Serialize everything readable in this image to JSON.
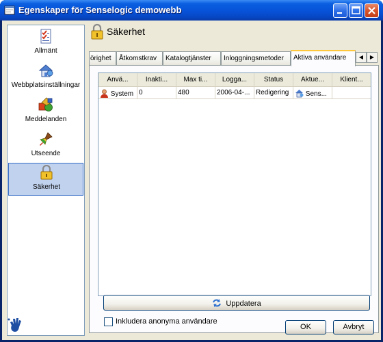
{
  "window": {
    "title": "Egenskaper för Senselogic demowebb"
  },
  "sidebar": {
    "items": [
      {
        "label": "Allmänt",
        "icon": "checklist-icon"
      },
      {
        "label": "Webbplatsinställningar",
        "icon": "house-icon"
      },
      {
        "label": "Meddelanden",
        "icon": "shapes-icon"
      },
      {
        "label": "Utseende",
        "icon": "paintbrush-icon"
      },
      {
        "label": "Säkerhet",
        "icon": "padlock-icon",
        "selected": true
      }
    ]
  },
  "page": {
    "title": "Säkerhet"
  },
  "tabs": [
    {
      "label": "Behörighet",
      "visible_label": "örighet"
    },
    {
      "label": "Åtkomstkrav"
    },
    {
      "label": "Katalogtjänster"
    },
    {
      "label": "Inloggningsmetoder"
    },
    {
      "label": "Aktiva användare",
      "active": true
    }
  ],
  "table": {
    "columns": [
      "Anvä...",
      "Inakti...",
      "Max ti...",
      "Logga...",
      "Status",
      "Aktue...",
      "Klient..."
    ],
    "rows": [
      {
        "user": "System",
        "inactive": "0",
        "max_time": "480",
        "logged": "2006-04-...",
        "status": "Redigering",
        "current": "Sens...",
        "client": ""
      }
    ]
  },
  "actions": {
    "update_label": "Uppdatera",
    "include_anonymous_label": "Inkludera anonyma användare",
    "include_anonymous_checked": false,
    "ok_label": "OK",
    "cancel_label": "Avbryt"
  },
  "colors": {
    "titlebar": "#0752d8",
    "selection": "#c1d2ee",
    "active_tab_accent": "#ffc83c"
  }
}
